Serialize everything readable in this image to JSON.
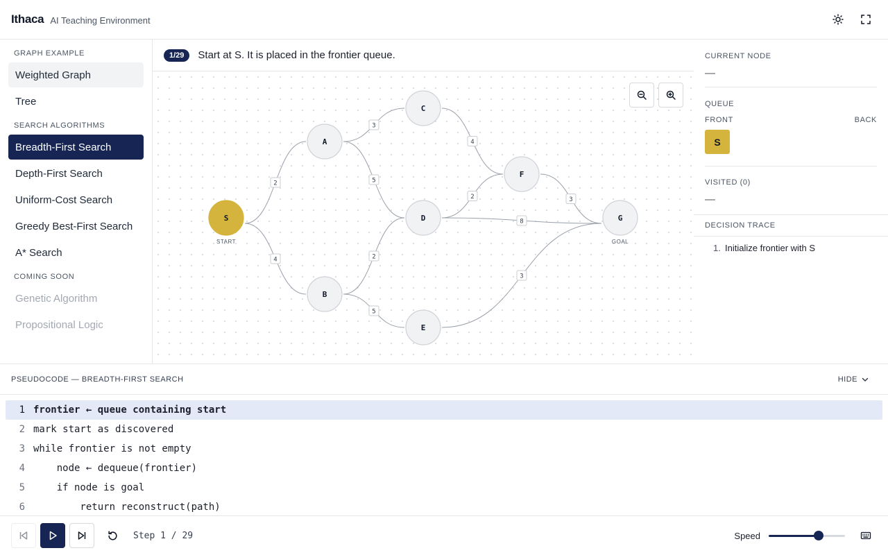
{
  "app": {
    "title": "Ithaca",
    "subtitle": "AI Teaching Environment"
  },
  "header": {
    "theme_icon": "sun-icon",
    "fullscreen_icon": "fullscreen-icon"
  },
  "sidebar": {
    "graph_section": "GRAPH EXAMPLE",
    "graph_items": [
      "Weighted Graph",
      "Tree"
    ],
    "search_section": "SEARCH ALGORITHMS",
    "search_items": [
      "Breadth-First Search",
      "Depth-First Search",
      "Uniform-Cost Search",
      "Greedy Best-First Search",
      "A* Search"
    ],
    "soon_section": "COMING SOON",
    "soon_items": [
      "Genetic Algorithm",
      "Propositional Logic"
    ],
    "selected_graph": "Weighted Graph",
    "selected_algorithm": "Breadth-First Search"
  },
  "stepbar": {
    "badge": "1/29",
    "message": "Start at S. It is placed in the frontier queue."
  },
  "graph": {
    "nodes": [
      {
        "id": "S",
        "label": "S",
        "sublabel": "START",
        "highlight": true
      },
      {
        "id": "A",
        "label": "A"
      },
      {
        "id": "B",
        "label": "B"
      },
      {
        "id": "C",
        "label": "C"
      },
      {
        "id": "D",
        "label": "D"
      },
      {
        "id": "E",
        "label": "E"
      },
      {
        "id": "F",
        "label": "F"
      },
      {
        "id": "G",
        "label": "G",
        "sublabel": "GOAL"
      }
    ],
    "edges": [
      {
        "from": "S",
        "to": "A",
        "weight": "2"
      },
      {
        "from": "S",
        "to": "B",
        "weight": "4"
      },
      {
        "from": "A",
        "to": "C",
        "weight": "3"
      },
      {
        "from": "A",
        "to": "D",
        "weight": "5"
      },
      {
        "from": "B",
        "to": "D",
        "weight": "2"
      },
      {
        "from": "B",
        "to": "E",
        "weight": "5"
      },
      {
        "from": "C",
        "to": "F",
        "weight": "4"
      },
      {
        "from": "D",
        "to": "F",
        "weight": "2"
      },
      {
        "from": "D",
        "to": "G",
        "weight": "8"
      },
      {
        "from": "F",
        "to": "G",
        "weight": "3"
      },
      {
        "from": "E",
        "to": "G",
        "weight": "3"
      }
    ],
    "colors": {
      "highlight": "#d4b43c",
      "node": "#f1f2f4",
      "node_border": "#cfd2d7",
      "edge": "#9aa0aa"
    }
  },
  "zoom": {
    "out_icon": "zoom-out-icon",
    "in_icon": "zoom-in-icon"
  },
  "right_panel": {
    "current_node_label": "CURRENT NODE",
    "current_node_value": "—",
    "queue_label": "QUEUE",
    "queue_front": "FRONT",
    "queue_back": "BACK",
    "queue_items": [
      "S"
    ],
    "visited_label": "VISITED (0)",
    "visited_value": "—",
    "trace_label": "DECISION TRACE",
    "trace": [
      {
        "num": "1.",
        "text": "Initialize frontier with S"
      }
    ]
  },
  "pseudocode": {
    "title": "PSEUDOCODE — BREADTH-FIRST SEARCH",
    "hide_label": "HIDE",
    "highlighted_line": 1,
    "lines": [
      {
        "n": "1",
        "text": "frontier ← queue containing start"
      },
      {
        "n": "2",
        "text": "mark start as discovered"
      },
      {
        "n": "3",
        "text": "while frontier is not empty"
      },
      {
        "n": "4",
        "text": "    node ← dequeue(frontier)"
      },
      {
        "n": "5",
        "text": "    if node is goal"
      },
      {
        "n": "6",
        "text": "        return reconstruct(path)"
      }
    ]
  },
  "controls": {
    "step_text": "Step 1 / 29",
    "speed_label": "Speed",
    "speed_fraction": 0.65,
    "accent": "#172554"
  }
}
